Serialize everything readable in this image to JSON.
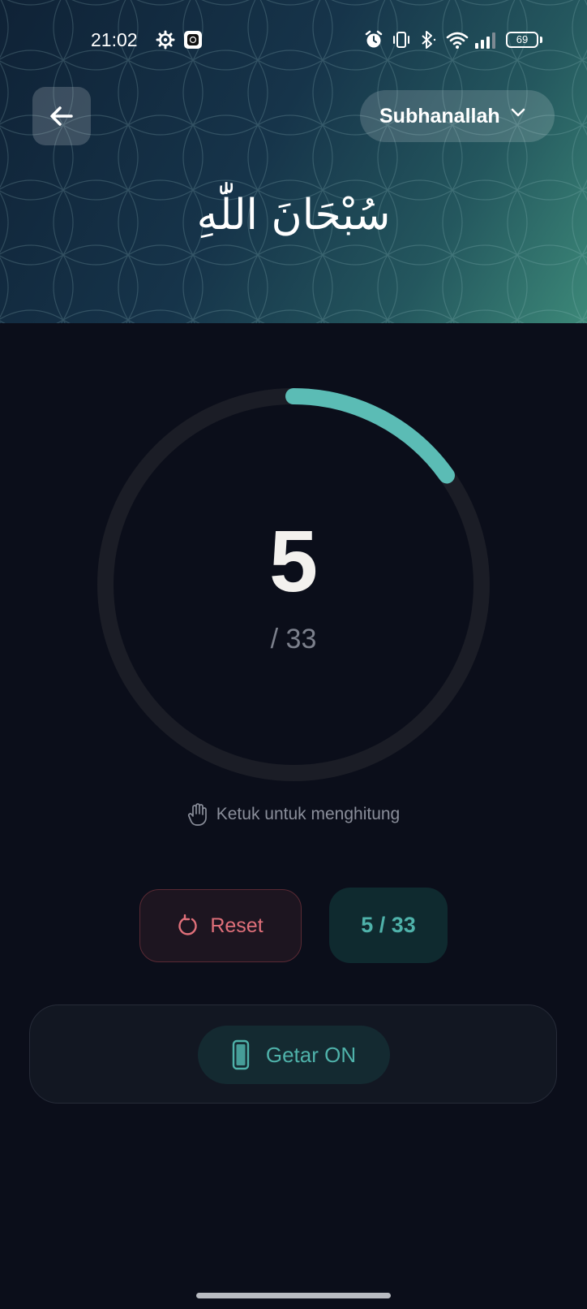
{
  "status_bar": {
    "time": "21:02",
    "battery_level": "69",
    "icons": [
      "settings-gear-icon",
      "app-notification-icon",
      "alarm-icon",
      "vibrate-icon",
      "bluetooth-icon",
      "wifi-icon",
      "signal-icon",
      "battery-icon"
    ]
  },
  "header": {
    "back_icon": "arrow-left-icon",
    "dhikr_selector": {
      "selected": "Subhanallah",
      "icon": "chevron-down-icon"
    },
    "arabic_text": "سُبْحَانَ اللّٰهِ"
  },
  "counter": {
    "count": "5",
    "target_label": "/ 33",
    "progress_fraction": 0.1515,
    "ring_color": "#5bbcb5",
    "track_color": "#1b1d26"
  },
  "hint": {
    "icon": "hand-icon",
    "text": "Ketuk untuk menghitung"
  },
  "actions": {
    "reset_label": "Reset",
    "reset_icon": "refresh-icon",
    "progress_text": "5 / 33"
  },
  "settings": {
    "vibrate_icon": "phone-icon",
    "vibrate_label": "Getar ON"
  },
  "colors": {
    "accent": "#4fb2aa",
    "reset": "#e0707a",
    "background": "#0b0e1a"
  }
}
